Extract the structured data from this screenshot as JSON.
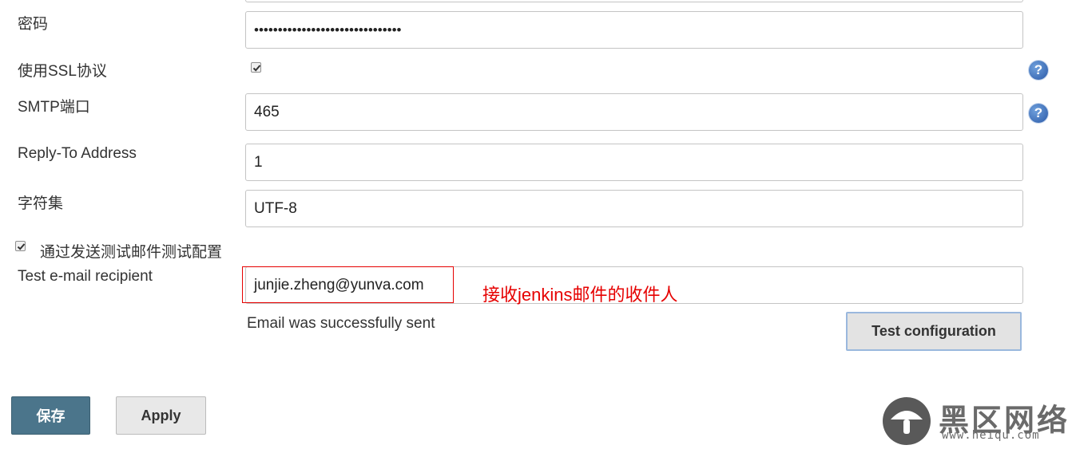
{
  "form": {
    "password": {
      "label": "密码",
      "value": "•••••••••••••••••••••••••••••••"
    },
    "ssl": {
      "label": "使用SSL协议",
      "checked": true
    },
    "smtp_port": {
      "label": "SMTP端口",
      "value": "465"
    },
    "reply_to": {
      "label": "Reply-To Address",
      "value": "1"
    },
    "charset": {
      "label": "字符集",
      "value": "UTF-8"
    },
    "test_email_toggle": {
      "label": "通过发送测试邮件测试配置",
      "checked": true
    },
    "test_recipient": {
      "label": "Test e-mail recipient",
      "value": "junjie.zheng@yunva.com"
    },
    "status_message": "Email was successfully sent",
    "test_button_label": "Test configuration"
  },
  "annotation": {
    "text": "接收jenkins邮件的收件人",
    "color": "#e60000"
  },
  "actions": {
    "save_label": "保存",
    "apply_label": "Apply"
  },
  "help_icon_glyph": "?",
  "watermark": {
    "text": "黑区网络",
    "url": "www.heiqu.com"
  },
  "colors": {
    "save_button": "#4b758b",
    "help_icon": "#2b5aa8",
    "annotation": "#e60000"
  }
}
